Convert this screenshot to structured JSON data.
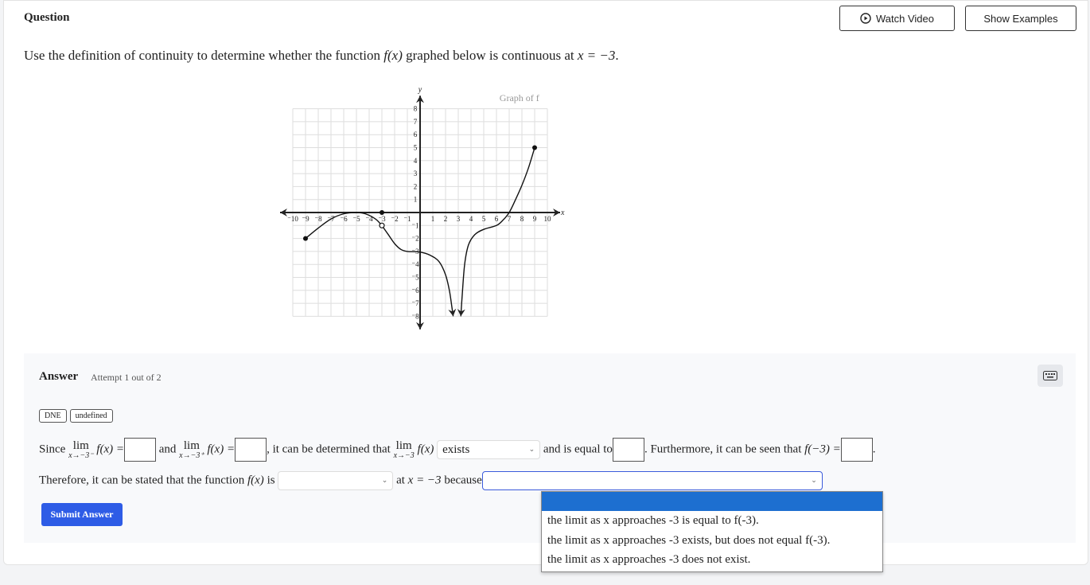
{
  "header": {
    "title": "Question",
    "watch_video": "Watch Video",
    "show_examples": "Show Examples"
  },
  "question": {
    "text_before": "Use the definition of continuity to determine whether the function ",
    "fx": "f(x)",
    "text_mid": " graphed below is continuous at ",
    "eq": "x = −3",
    "text_end": "."
  },
  "chart_data": {
    "type": "line",
    "title": "Graph of f",
    "xlabel": "x",
    "ylabel": "y",
    "xlim": [
      -10,
      10
    ],
    "ylim": [
      -8,
      8
    ],
    "grid": true,
    "x_ticks": [
      -10,
      -9,
      -8,
      -7,
      -6,
      -5,
      -4,
      -3,
      -2,
      -1,
      1,
      2,
      3,
      4,
      5,
      6,
      7,
      8,
      9,
      10
    ],
    "y_ticks": [
      -8,
      -7,
      -6,
      -5,
      -4,
      -3,
      -2,
      -1,
      1,
      2,
      3,
      4,
      5,
      6,
      7,
      8
    ],
    "segments": [
      {
        "points": [
          [
            -9,
            -2
          ],
          [
            -8,
            -1.2
          ],
          [
            -7,
            -0.5
          ],
          [
            -6,
            -0.1
          ],
          [
            -5,
            0
          ],
          [
            -4.3,
            -0.1
          ],
          [
            -3.5,
            -0.5
          ],
          [
            -3,
            -1
          ]
        ],
        "end_arrow": false
      },
      {
        "points": [
          [
            -3,
            -1
          ],
          [
            -2.5,
            -1.7
          ],
          [
            -2,
            -2.4
          ],
          [
            -1.5,
            -2.85
          ],
          [
            -1,
            -3
          ],
          [
            0,
            -3.05
          ],
          [
            0.8,
            -3.3
          ],
          [
            1.5,
            -3.8
          ],
          [
            2,
            -4.8
          ],
          [
            2.3,
            -6
          ],
          [
            2.5,
            -7.3
          ],
          [
            2.6,
            -8
          ]
        ],
        "end_arrow": true
      },
      {
        "points": [
          [
            9,
            5
          ],
          [
            8.5,
            3.4
          ],
          [
            8,
            2.1
          ],
          [
            7.5,
            1
          ],
          [
            7,
            0
          ],
          [
            6.5,
            -0.6
          ],
          [
            6,
            -1
          ],
          [
            5,
            -1.3
          ],
          [
            4.3,
            -1.7
          ],
          [
            3.8,
            -2.5
          ],
          [
            3.5,
            -4
          ],
          [
            3.3,
            -6.5
          ],
          [
            3.2,
            -8
          ]
        ],
        "end_arrow": true
      }
    ],
    "closed_points": [
      [
        -9,
        -2
      ],
      [
        -3,
        0
      ],
      [
        9,
        5
      ]
    ],
    "open_points": [
      [
        -3,
        -1
      ]
    ]
  },
  "answer": {
    "label": "Answer",
    "attempt": "Attempt 1 out of 2",
    "chips": [
      "DNE",
      "undefined"
    ],
    "line1": {
      "since": "Since",
      "lim": "lim",
      "sub_left": "x→−3⁻",
      "sub_right": "x→−3⁺",
      "sub_both": "x→−3",
      "fx_eq": "f(x) =",
      "and": "and",
      "determined": ", it can be determined that",
      "fx": "f(x)",
      "select_value": "exists",
      "equal_to": "and is equal to",
      "furthermore": ". Furthermore, it can be seen that",
      "f_minus3": "f(−3) =",
      "period": "."
    },
    "line2": {
      "therefore": "Therefore, it can be stated that the function",
      "fx": "f(x)",
      "is": "is",
      "select_value": "",
      "at": "at",
      "eq": "x = −3",
      "because": "because",
      "because_value": ""
    },
    "dropdown_options": [
      "",
      "the limit as x approaches -3 is equal to f(-3).",
      "the limit as x approaches -3 exists, but does not equal f(-3).",
      "the limit as x approaches -3 does not exist."
    ],
    "submit": "Submit Answer"
  }
}
